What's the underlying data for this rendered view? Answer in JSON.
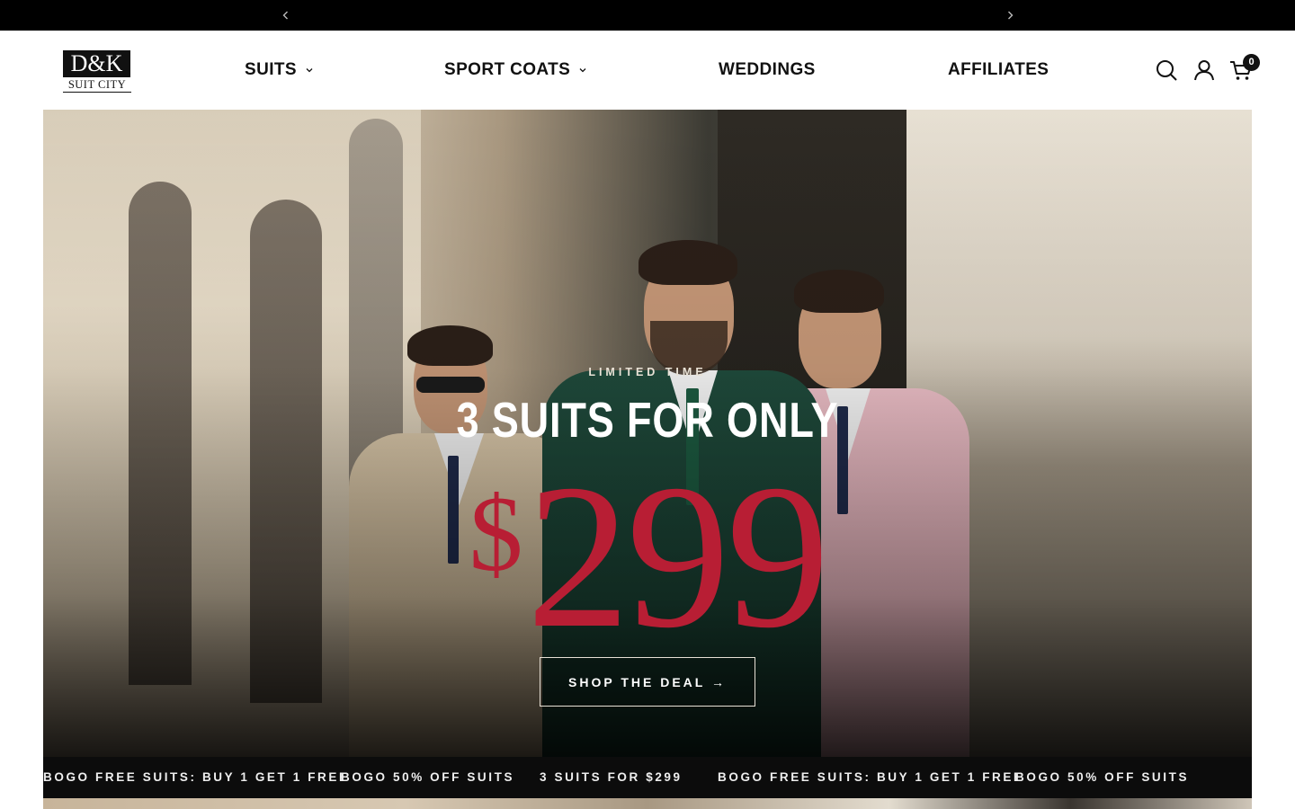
{
  "announcement_bar": {
    "prev_icon": "chevron-left-icon",
    "next_icon": "chevron-right-icon"
  },
  "header": {
    "logo": {
      "monogram": "D&K",
      "subtitle": "SUIT CITY"
    },
    "nav": [
      {
        "label": "SUITS",
        "has_dropdown": true
      },
      {
        "label": "SPORT COATS",
        "has_dropdown": true
      },
      {
        "label": "WEDDINGS",
        "has_dropdown": false
      },
      {
        "label": "AFFILIATES",
        "has_dropdown": false
      }
    ],
    "icons": [
      "search-icon",
      "account-icon",
      "cart-icon"
    ],
    "cart_count": "0"
  },
  "hero": {
    "eyebrow": "LIMITED TIME",
    "headline": "3 SUITS FOR ONLY",
    "price_symbol": "$",
    "price_value": "299",
    "cta_label": "SHOP THE DEAL →"
  },
  "marquee": {
    "items": [
      "BOGO FREE SUITS: BUY 1 GET 1 FREE",
      "BOGO 50% OFF SUITS",
      "3 SUITS FOR $299",
      "BOGO FREE SUITS: BUY 1 GET 1 FREE",
      "BOGO 50% OFF SUITS"
    ]
  },
  "colors": {
    "announcement_bg": "#000000",
    "price_red": "#b81e34",
    "marquee_bg": "#0c0c0c"
  }
}
